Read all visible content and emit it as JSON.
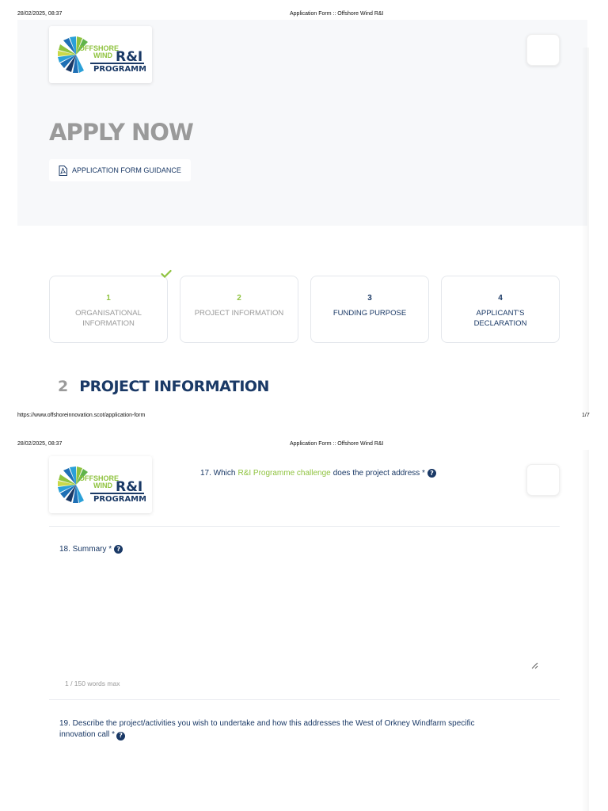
{
  "print_header": {
    "datetime": "28/02/2025, 08:37",
    "title": "Application Form :: Offshore Wind R&I",
    "url": "https://www.offshoreinnovation.scot/application-form",
    "page": "1/7"
  },
  "logo": {
    "alt": "Offshore Wind R&I Programme"
  },
  "hero": {
    "title": "APPLY NOW",
    "guidance_link": "APPLICATION FORM GUIDANCE"
  },
  "steps": [
    {
      "number": "1",
      "label": "ORGANISATIONAL INFORMATION",
      "state": "done"
    },
    {
      "number": "2",
      "label": "PROJECT INFORMATION",
      "state": "current"
    },
    {
      "number": "3",
      "label": "FUNDING PURPOSE",
      "state": "todo"
    },
    {
      "number": "4",
      "label": "APPLICANT'S DECLARATION",
      "state": "todo"
    }
  ],
  "section": {
    "number": "2",
    "title": "PROJECT INFORMATION"
  },
  "questions": {
    "q17": {
      "prefix": "17. Which",
      "link": "R&I Programme challenge",
      "suffix": "does the project address *"
    },
    "q18": {
      "label": "18. Summary *",
      "word_count": "1 / 150 words max"
    },
    "q19": {
      "label": "19. Describe the project/activities you wish to undertake and how this addresses the West of Orkney Windfarm specific innovation call *"
    }
  },
  "colors": {
    "navy": "#1a3966",
    "green": "#8fc33f",
    "grey": "#9a9a9a"
  },
  "icons": {
    "help": "question-circle-icon",
    "pdf": "pdf-file-icon",
    "check": "check-icon",
    "resize": "resize-handle-icon"
  }
}
